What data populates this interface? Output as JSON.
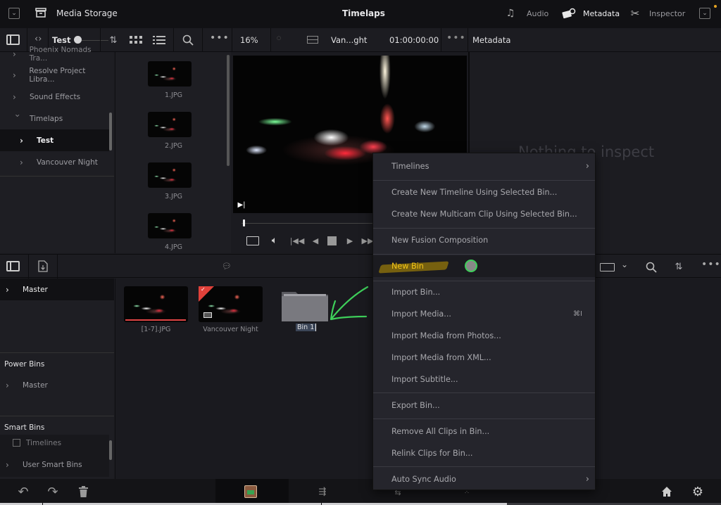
{
  "topbar": {
    "left_label": "Media Storage",
    "title": "Timelaps",
    "tabs": [
      {
        "label": "Audio",
        "icon": "music-note-icon",
        "active": false
      },
      {
        "label": "Metadata",
        "icon": "metadata-tag-icon",
        "active": true
      },
      {
        "label": "Inspector",
        "icon": "tools-icon",
        "active": false
      }
    ]
  },
  "toolbar": {
    "bin_name": "Test",
    "zoom": "16%",
    "clip_name": "Van...ght",
    "timecode": "01:00:00:00",
    "panel_title": "Metadata"
  },
  "bin_tree": [
    {
      "label": "Phoenix Nomads Tra...",
      "expanded": false,
      "level": 0
    },
    {
      "label": "Resolve Project Libra...",
      "expanded": false,
      "level": 0
    },
    {
      "label": "Sound Effects",
      "expanded": false,
      "level": 0
    },
    {
      "label": "Timelaps",
      "expanded": true,
      "level": 0
    },
    {
      "label": "Test",
      "expanded": false,
      "level": 1,
      "selected": true
    },
    {
      "label": "Vancouver Night",
      "expanded": false,
      "level": 1
    }
  ],
  "thumbnails": [
    {
      "label": "1.JPG"
    },
    {
      "label": "2.JPG"
    },
    {
      "label": "3.JPG"
    },
    {
      "label": "4.JPG"
    }
  ],
  "viewer": {
    "playhead_progress": 0.0
  },
  "inspector": {
    "empty_message": "Nothing to inspect"
  },
  "media_pool": {
    "master_label": "Master",
    "items": [
      {
        "label": "[1-7].JPG",
        "type": "image-sequence"
      },
      {
        "label": "Vancouver Night",
        "type": "timeline",
        "checked": true
      },
      {
        "label": "Bin 1",
        "type": "bin",
        "editing": true
      }
    ]
  },
  "power_bins": {
    "header": "Power Bins",
    "items": [
      {
        "label": "Master"
      }
    ]
  },
  "smart_bins": {
    "header": "Smart Bins",
    "items": [
      {
        "label": "Timelines"
      },
      {
        "label": "User Smart Bins"
      }
    ]
  },
  "context_menu": {
    "items": [
      {
        "label": "Timelines",
        "submenu": true
      },
      {
        "label": "Create New Timeline Using Selected Bin..."
      },
      {
        "label": "Create New Multicam Clip Using Selected Bin..."
      },
      {
        "label": "New Fusion Composition"
      },
      {
        "label": "New Bin",
        "highlighted": true
      },
      {
        "label": "Import Bin..."
      },
      {
        "label": "Import Media...",
        "shortcut": "⌘I"
      },
      {
        "label": "Import Media from Photos..."
      },
      {
        "label": "Import Media from XML..."
      },
      {
        "label": "Import Subtitle..."
      },
      {
        "label": "Export Bin..."
      },
      {
        "label": "Remove All Clips in Bin..."
      },
      {
        "label": "Relink Clips for Bin..."
      },
      {
        "label": "Auto Sync Audio",
        "submenu": true
      }
    ]
  },
  "colors": {
    "highlight_text": "#f2c418",
    "annotation_green": "#3ecf5a",
    "flag_red": "#e0413a"
  }
}
